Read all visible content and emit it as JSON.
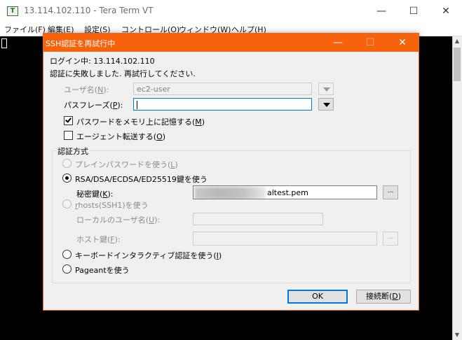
{
  "window": {
    "title": "13.114.102.110 - Tera Term VT",
    "icon_text": "T",
    "controls": {
      "minimize": "—",
      "maximize": "☐",
      "close": "✕"
    }
  },
  "menu": [
    "ファイル(F)",
    "編集(E)",
    "設定(S)",
    "コントロール(O)",
    "ウィンドウ(W)",
    "ヘルプ(H)"
  ],
  "dialog": {
    "title": "SSH認証を再試行中",
    "controls": {
      "minimize": "—",
      "maximize": "☐",
      "close": "✕"
    },
    "login_line": "ログイン中: 13.114.102.110",
    "message": "認証に失敗しました. 再試行してください.",
    "username": {
      "label": "ユーザ名(",
      "key": "N",
      "suffix": "):",
      "value": "ec2-user"
    },
    "passphrase": {
      "label": "パスフレーズ(",
      "key": "P",
      "suffix": "):",
      "value": ""
    },
    "remember_password": {
      "label": "パスワードをメモリ上に記憶する(",
      "key": "M",
      "suffix": ")",
      "checked": true
    },
    "agent_forwarding": {
      "label": "エージェント転送する(",
      "key": "O",
      "suffix": ")",
      "checked": false
    },
    "auth_method_label": "認証方式",
    "methods": {
      "plain": {
        "label": "プレインパスワードを使う(",
        "key": "L",
        "suffix": ")",
        "selected": false,
        "enabled": false
      },
      "rsa": {
        "label": "RSA/DSA/ECDSA/ED25519鍵を使う",
        "selected": true,
        "enabled": true
      },
      "private_key": {
        "label": "秘密鍵(",
        "key": "K",
        "suffix": "):",
        "value": "altest.pem",
        "browse": "..."
      },
      "rhosts": {
        "label": "hosts(SSH1)を使う",
        "key": "r",
        "selected": false,
        "enabled": false
      },
      "local_user": {
        "label": "ローカルのユーザ名(",
        "key": "U",
        "suffix": "):"
      },
      "host_key": {
        "label": "ホスト鍵(",
        "key": "F",
        "suffix": "):",
        "browse": "..."
      },
      "keyboard": {
        "label": "キーボードインタラクティブ認証を使う(",
        "key": "I",
        "suffix": ")",
        "selected": false,
        "enabled": true
      },
      "pageant": {
        "label": "Pageantを使う",
        "selected": false,
        "enabled": true
      }
    },
    "buttons": {
      "ok": "OK",
      "disconnect": {
        "label": "接続断(",
        "key": "D",
        "suffix": ")"
      }
    }
  },
  "colors": {
    "dialog_title": "#f7630c",
    "focus": "#0078d7",
    "terminal": "#000000"
  }
}
